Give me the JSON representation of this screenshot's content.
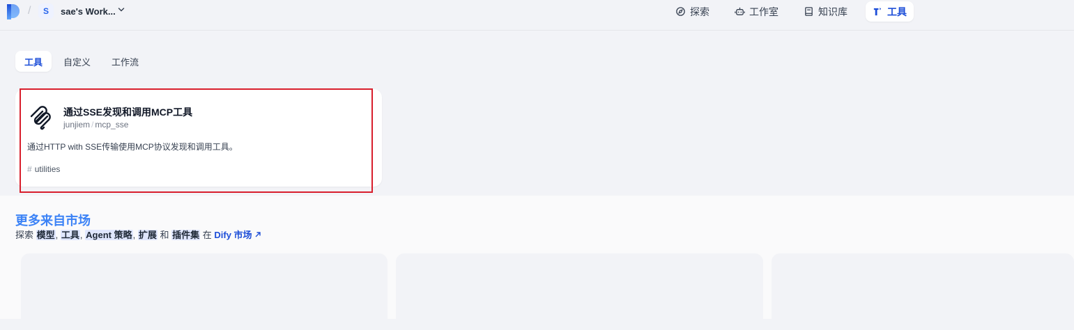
{
  "header": {
    "workspace_initial": "S",
    "workspace_name": "sae's Work...",
    "nav": [
      {
        "label": "探索",
        "icon": "compass-icon"
      },
      {
        "label": "工作室",
        "icon": "robot-icon"
      },
      {
        "label": "知识库",
        "icon": "book-icon"
      },
      {
        "label": "工具",
        "icon": "tool-icon",
        "active": true
      }
    ]
  },
  "tabs": [
    {
      "label": "工具",
      "active": true
    },
    {
      "label": "自定义"
    },
    {
      "label": "工作流"
    }
  ],
  "tool_card": {
    "title": "通过SSE发现和调用MCP工具",
    "author": "junjiem",
    "name": "mcp_sse",
    "description": "通过HTTP with SSE传输使用MCP协议发现和调用工具。",
    "tag": "utilities",
    "icon": "mcp-icon"
  },
  "marketplace": {
    "title": "更多来自市场",
    "prefix": "探索",
    "items": [
      "模型",
      "工具",
      "Agent 策略",
      "扩展",
      "插件集"
    ],
    "sep": ", ",
    "and": "和",
    "in": "在",
    "link_label": "Dify 市场",
    "link_icon": "arrow-up-right-icon"
  },
  "colors": {
    "accent": "#1d4ed8",
    "highlight_border": "#d81e2c",
    "market_title": "#3b82f6"
  }
}
